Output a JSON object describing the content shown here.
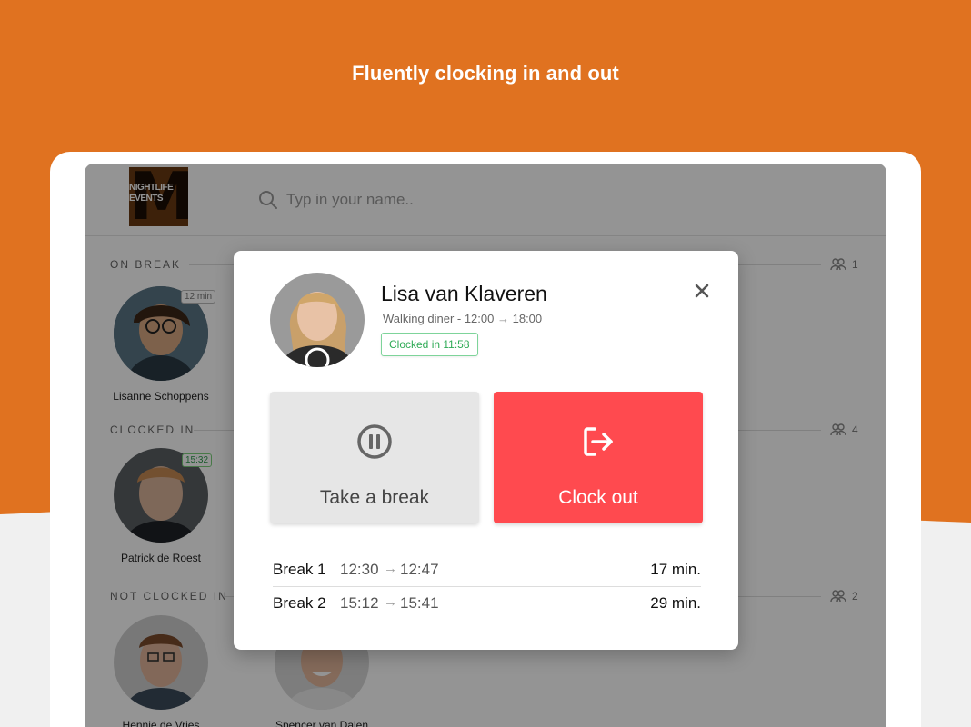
{
  "page": {
    "headline": "Fluently clocking in and out",
    "colors": {
      "orange": "#E07220",
      "clock_out_red": "#FF4A4F",
      "status_green": "#2EAA55"
    }
  },
  "app": {
    "logo": {
      "top_text": "NIGHTLIFE",
      "bottom_text": "EVENTS",
      "letter": "M"
    },
    "search": {
      "placeholder": "Typ in your name..",
      "icon": "search-icon"
    }
  },
  "sections": [
    {
      "label": "ON BREAK",
      "count": "1",
      "people": [
        {
          "name": "Lisanne Schoppens",
          "badge": "12 min",
          "badge_style": "gray"
        }
      ]
    },
    {
      "label": "CLOCKED IN",
      "count": "4",
      "people": [
        {
          "name": "Patrick de Roest",
          "badge": "15:32",
          "badge_style": "green"
        }
      ]
    },
    {
      "label": "NOT CLOCKED IN",
      "count": "2",
      "people": [
        {
          "name": "Hennie de Vries"
        },
        {
          "name": "Spencer van Dalen"
        }
      ]
    }
  ],
  "modal": {
    "name": "Lisa van Klaveren",
    "shift_prefix": "Walking diner - 12:00",
    "shift_end": "18:00",
    "status": "Clocked in 11:58",
    "close_icon": "close-icon",
    "actions": {
      "break_label": "Take a break",
      "clock_out_label": "Clock out"
    },
    "breaks": [
      {
        "label": "Break 1",
        "start": "12:30",
        "end": "12:47",
        "duration": "17 min."
      },
      {
        "label": "Break 2",
        "start": "15:12",
        "end": "15:41",
        "duration": "29 min."
      }
    ]
  }
}
